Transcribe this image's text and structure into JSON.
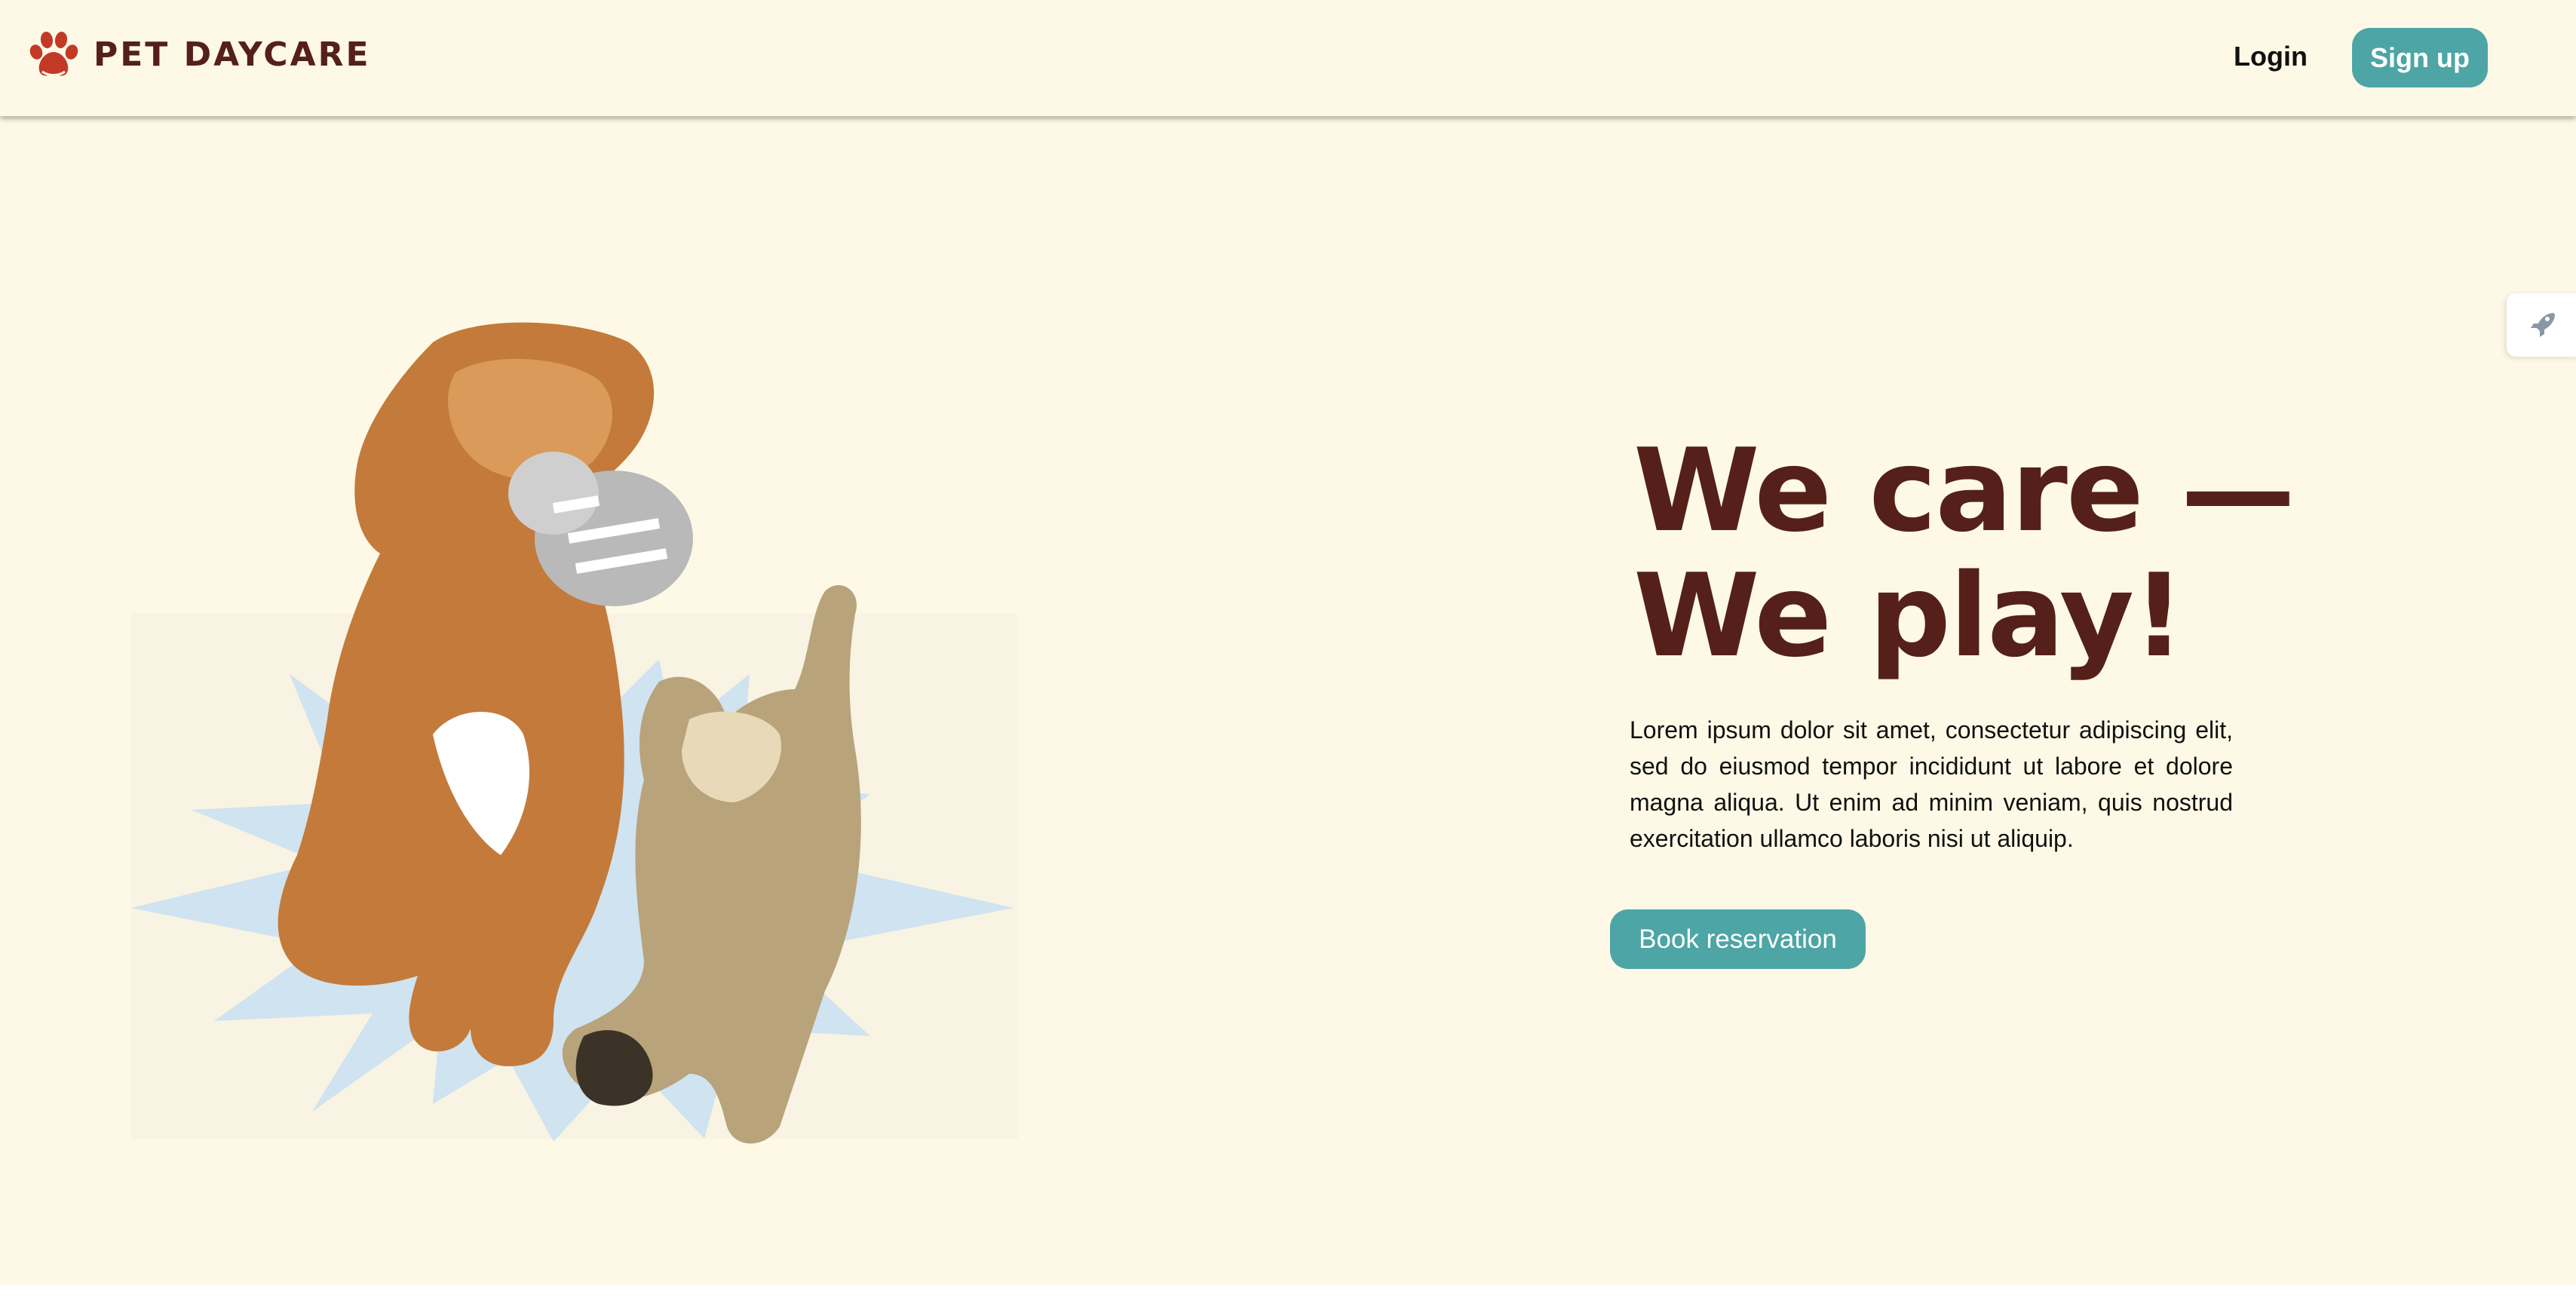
{
  "header": {
    "brand_name": "PET DAYCARE",
    "brand_icon": "paw-icon",
    "login_label": "Login",
    "signup_label": "Sign up"
  },
  "hero": {
    "title_line1": "We care —",
    "title_line2": "We play!",
    "description": "Lorem ipsum dolor sit amet, consectetur adipiscing elit, sed do eiusmod tempor incididunt ut labore et dolore magna aliqua. Ut enim ad minim veniam, quis nostrud exercitation ullamco laboris nisi ut aliquip.",
    "cta_label": "Book reservation",
    "image": "dog-and-cat-illustration"
  },
  "side_widget": {
    "icon": "rocket-icon"
  },
  "colors": {
    "background": "#fdf9e6",
    "brand_brown": "#55201a",
    "accent_teal": "#4ea5a5",
    "starburst_blue": "#cfe3f1",
    "paw_red": "#c0392b"
  }
}
